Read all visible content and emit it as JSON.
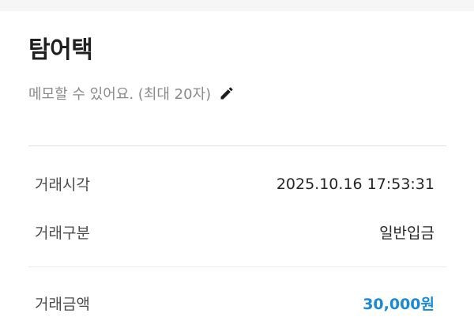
{
  "header": {
    "title": "탐어택"
  },
  "memo": {
    "placeholder": "메모할 수 있어요. (최대 20자)",
    "icon": "pencil-icon"
  },
  "details": [
    {
      "label": "거래시각",
      "value": "2025.10.16 17:53:31"
    },
    {
      "label": "거래구분",
      "value": "일반입금"
    }
  ],
  "amount": {
    "label": "거래금액",
    "value": "30,000원",
    "color": "#1a8ad8"
  }
}
